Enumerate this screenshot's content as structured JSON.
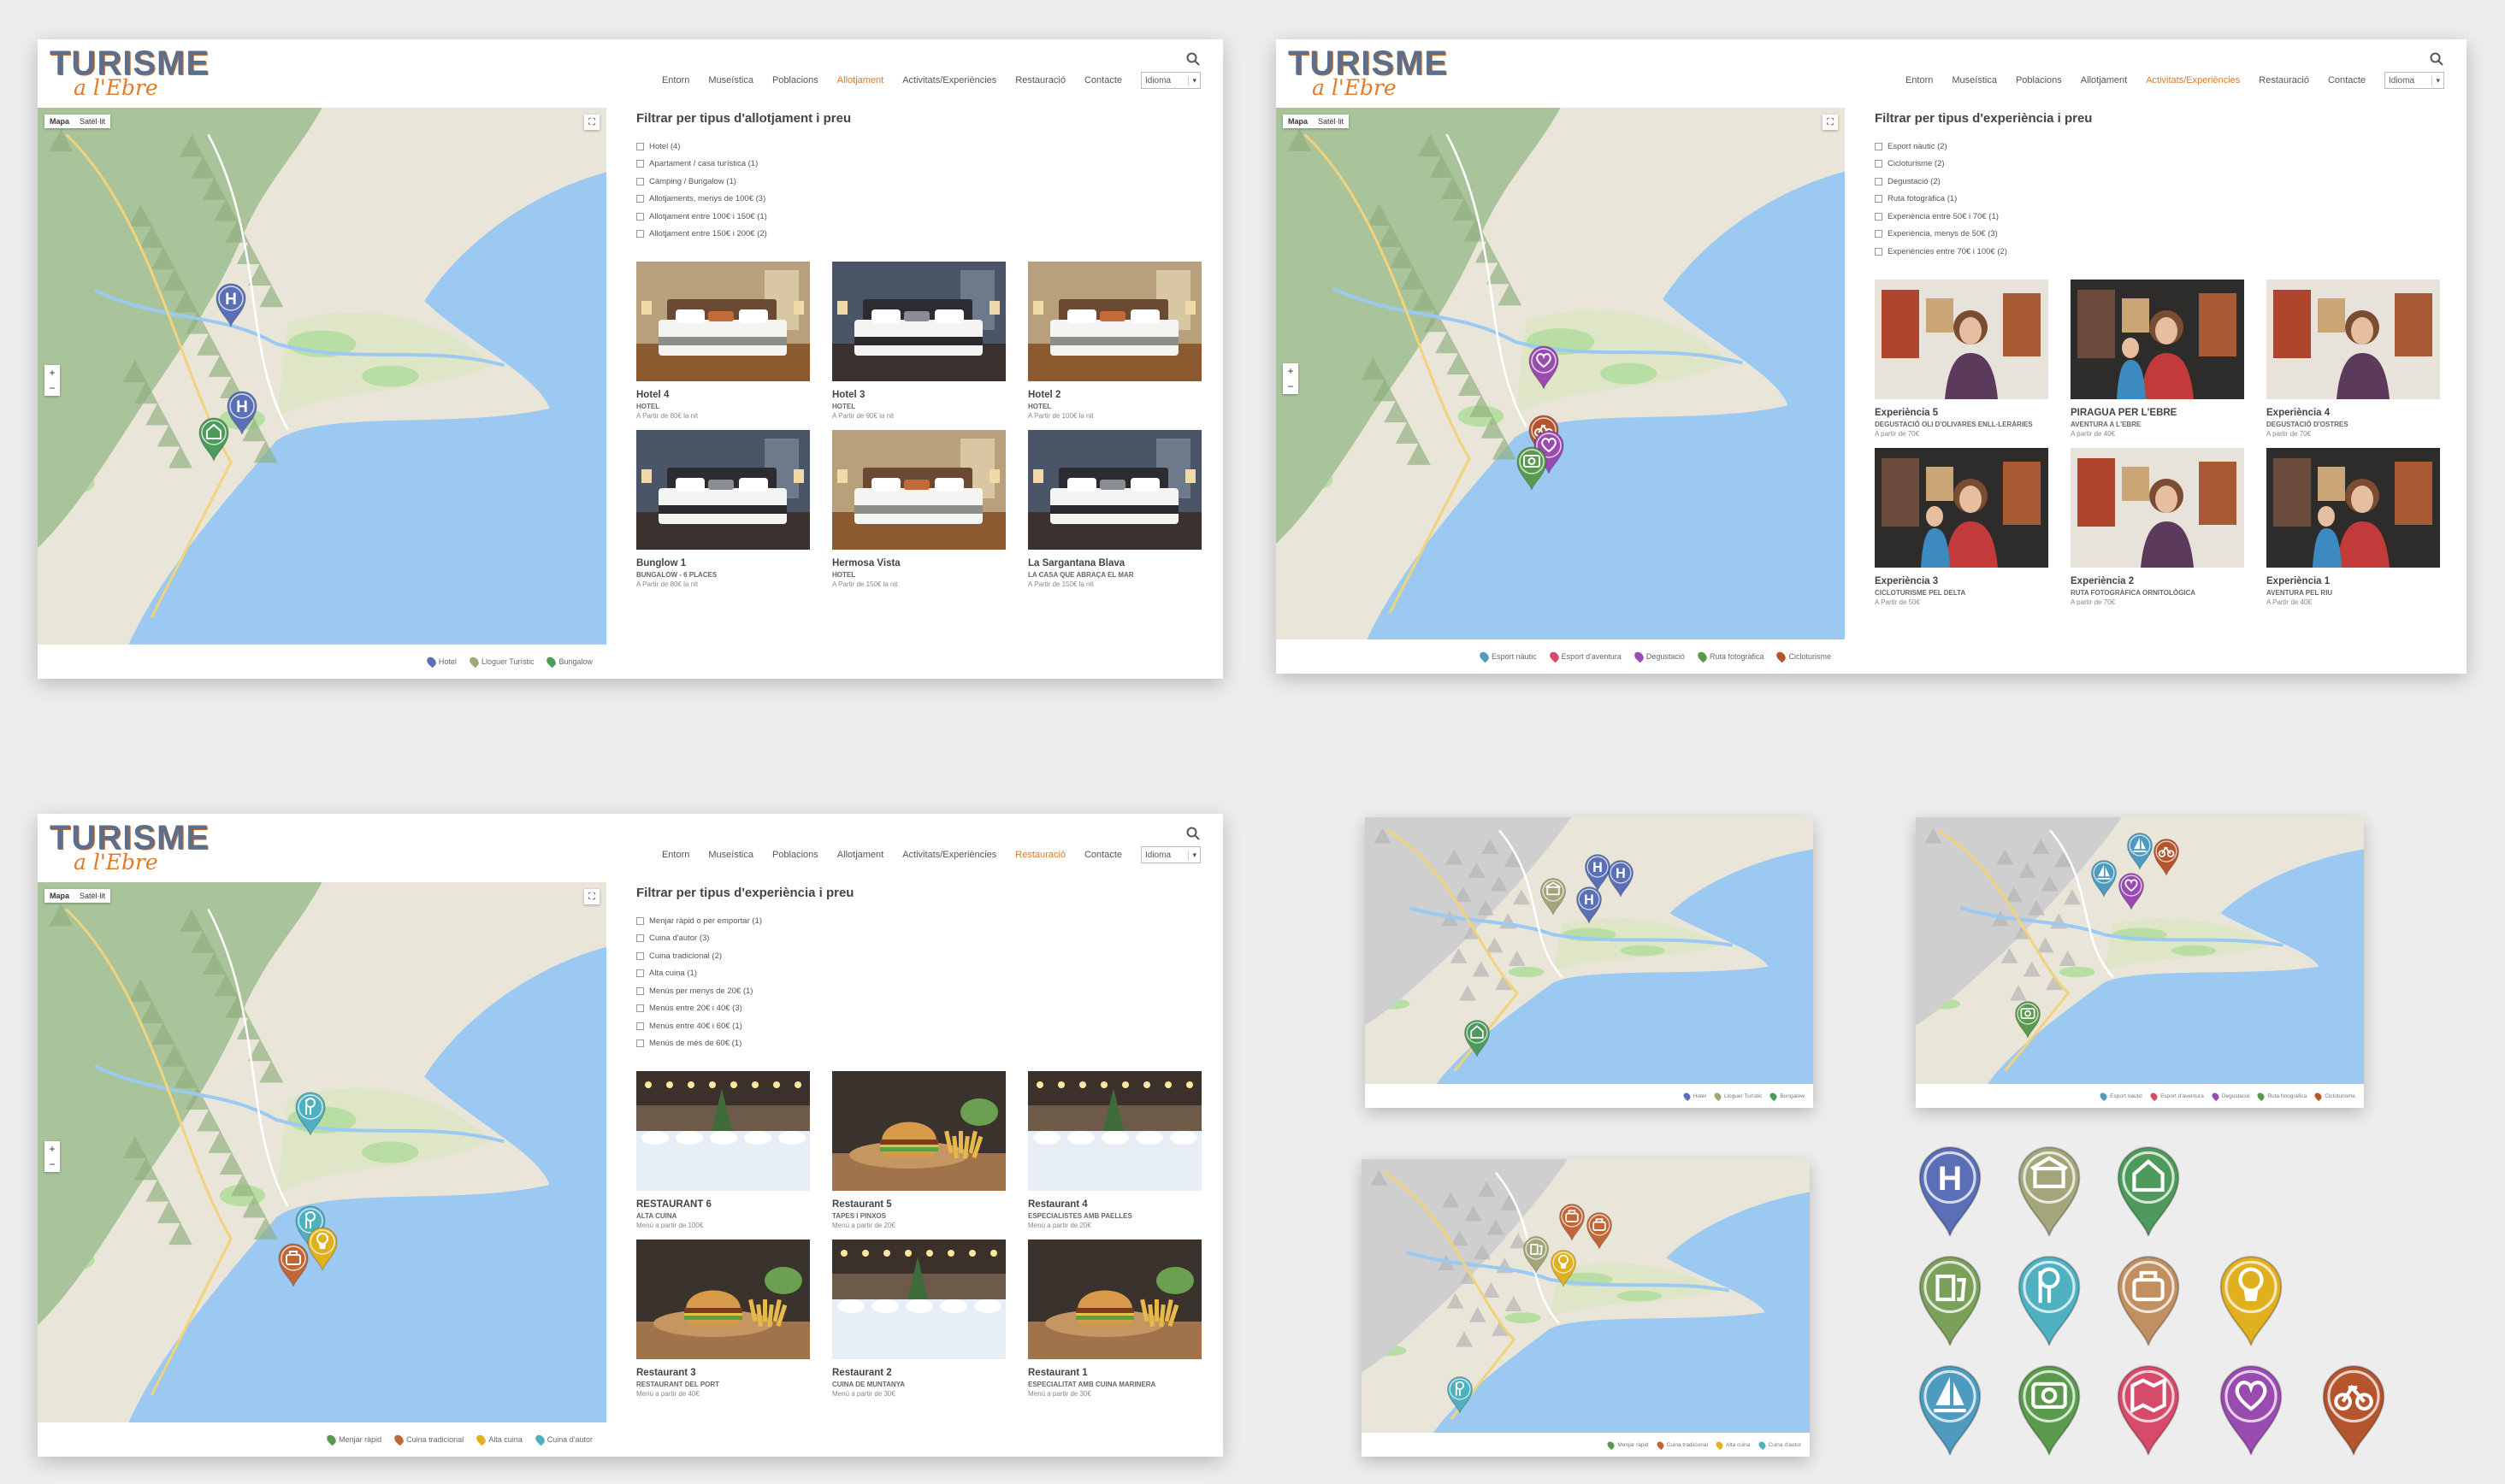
{
  "site": {
    "logo_main": "TURISME",
    "logo_sub": "a l'Ebre",
    "language_label": "Idioma",
    "nav": [
      "Entorn",
      "Museística",
      "Poblacions",
      "Allotjament",
      "Activitats/Experiències",
      "Restauració",
      "Contacte"
    ]
  },
  "map_ui": {
    "type_map": "Mapa",
    "type_satellite": "Satèl·lit",
    "zoom_in": "+",
    "zoom_out": "−"
  },
  "panels": {
    "accommodation": {
      "active_nav": 3,
      "filter_title": "Filtrar per tipus d'allotjament i preu",
      "filters": [
        "Hotel (4)",
        "Apartament / casa turística (1)",
        "Càmping / Bungalow (1)",
        "Allotjaments, menys de 100€ (3)",
        "Allotjament entre 100€ i 150€ (1)",
        "Allotjament entre 150€ i 200€ (2)"
      ],
      "cards": [
        {
          "title": "Hotel 4",
          "subtitle": "HOTEL",
          "price": "A Partir de 80€ la nit",
          "image": "bedroom"
        },
        {
          "title": "Hotel 3",
          "subtitle": "HOTEL",
          "price": "A Partir de 90€ la nit",
          "image": "bedroom-dark"
        },
        {
          "title": "Hotel 2",
          "subtitle": "HOTEL",
          "price": "A Partir de 100€ la nit",
          "image": "bedroom"
        },
        {
          "title": "Bunglow 1",
          "subtitle": "BUNGALOW - 6 PLACES",
          "price": "A Partir de 80€ la nit",
          "image": "bedroom-dark"
        },
        {
          "title": "Hermosa Vista",
          "subtitle": "HOTEL",
          "price": "A Partir de 150€ la nit",
          "image": "bedroom"
        },
        {
          "title": "La Sargantana Blava",
          "subtitle": "LA CASA QUE ABRAÇA EL MAR",
          "price": "A Partir de 150€ la nit",
          "image": "bedroom-dark"
        }
      ],
      "legend": [
        {
          "label": "Hotel",
          "color": "#5a6fb5"
        },
        {
          "label": "Lloguer Turístic",
          "color": "#a3a67a"
        },
        {
          "label": "Bungalow",
          "color": "#4e9a5c"
        }
      ],
      "markers": [
        {
          "icon": "hotel-marker-icon",
          "color": "#5a6fb5"
        },
        {
          "icon": "hotel-marker-icon",
          "color": "#5a6fb5"
        },
        {
          "icon": "bungalow-marker-icon",
          "color": "#4e9a5c"
        }
      ]
    },
    "experiences": {
      "active_nav": 4,
      "filter_title": "Filtrar per tipus d'experiència i preu",
      "filters": [
        "Esport nàutic (2)",
        "Cicloturisme (2)",
        "Degustació (2)",
        "Ruta fotogràfica (1)",
        "Experiència entre 50€ i 70€ (1)",
        "Experiència, menys de 50€ (3)",
        "Experiències entre 70€ i 100€ (2)"
      ],
      "cards": [
        {
          "title": "Experiència 5",
          "subtitle": "Degustació oli d'olivares enll·leràries",
          "price": "A partir de 70€",
          "image": "gallery"
        },
        {
          "title": "PIRAGUA PER L'EBRE",
          "subtitle": "AVENTURA A L'EBRE",
          "price": "A partir de 40€",
          "image": "gallery-kids"
        },
        {
          "title": "Experiència 4",
          "subtitle": "Degustació d'ostres",
          "price": "A partir de 70€",
          "image": "gallery"
        },
        {
          "title": "Experiència 3",
          "subtitle": "cicloturisme pel delta",
          "price": "A Partir de 50€",
          "image": "gallery-kids"
        },
        {
          "title": "Experiència 2",
          "subtitle": "Ruta fotogràfica ornitològica",
          "price": "A partir de 70€",
          "image": "gallery"
        },
        {
          "title": "Experiència 1",
          "subtitle": "AVENTURA PEL RIU",
          "price": "A Partir de 40€",
          "image": "gallery-kids"
        }
      ],
      "legend": [
        {
          "label": "Esport nàutic",
          "color": "#4f9bc0"
        },
        {
          "label": "Esport d'aventura",
          "color": "#d64a6a"
        },
        {
          "label": "Degustació",
          "color": "#9a4bb0"
        },
        {
          "label": "Ruta fotogràfica",
          "color": "#5a9a4c"
        },
        {
          "label": "Cicloturisme",
          "color": "#b4552e"
        }
      ],
      "markers": [
        {
          "icon": "tasting-marker-icon",
          "color": "#9a4bb0"
        },
        {
          "icon": "cycling-marker-icon",
          "color": "#b4552e"
        },
        {
          "icon": "tasting-marker-icon",
          "color": "#9a4bb0"
        },
        {
          "icon": "photo-marker-icon",
          "color": "#5a9a4c"
        }
      ]
    },
    "restaurants": {
      "active_nav": 5,
      "filter_title": "Filtrar per tipus d'experiència i preu",
      "filters": [
        "Menjar ràpid o per emportar (1)",
        "Cuina d'autor (3)",
        "Cuina tradicional (2)",
        "Alta cuina (1)",
        "Menús per menys de 20€ (1)",
        "Menús entre 20€ i 40€ (3)",
        "Menús entre 40€ i 60€ (1)",
        "Menús de més de 60€ (1)"
      ],
      "cards": [
        {
          "title": "RESTAURANT 6",
          "subtitle": "Alta cuina",
          "price": "Menú a partir de 100€",
          "image": "dining"
        },
        {
          "title": "Restaurant 5",
          "subtitle": "TAPES I PINXOS",
          "price": "Menú a partir de 20€",
          "image": "burger"
        },
        {
          "title": "Restaurant 4",
          "subtitle": "ESPECIALISTES AMB PAELLES",
          "price": "Menú a partir de 20€",
          "image": "dining"
        },
        {
          "title": "Restaurant 3",
          "subtitle": "RESTAURANT DEL PORT",
          "price": "Menú a partir de 40€",
          "image": "burger"
        },
        {
          "title": "Restaurant 2",
          "subtitle": "CUINA DE MUNTANYA",
          "price": "Menú a partir de 30€",
          "image": "dining"
        },
        {
          "title": "Restaurant 1",
          "subtitle": "ESPECIALITAT AMB CUINA MARINERA",
          "price": "Menú a partir de 30€",
          "image": "burger"
        }
      ],
      "legend": [
        {
          "label": "Menjar ràpid",
          "color": "#5a9a4c"
        },
        {
          "label": "Cuina tradicional",
          "color": "#c0673a"
        },
        {
          "label": "Alta cuina",
          "color": "#e0b01e"
        },
        {
          "label": "Cuina d'autor",
          "color": "#4fb0c0"
        }
      ],
      "markers": [
        {
          "icon": "fork-knife-marker-icon",
          "color": "#4fb0c0"
        },
        {
          "icon": "fork-knife-marker-icon",
          "color": "#4fb0c0"
        },
        {
          "icon": "haute-cuisine-marker-icon",
          "color": "#e0b01e"
        },
        {
          "icon": "traditional-marker-icon",
          "color": "#c0673a"
        }
      ]
    }
  },
  "thumbnails": [
    {
      "legend": [
        {
          "label": "Hotel",
          "color": "#5a6fb5"
        },
        {
          "label": "Lloguer Turístic",
          "color": "#a3a67a"
        },
        {
          "label": "Bungalow",
          "color": "#4e9a5c"
        }
      ],
      "markers": [
        {
          "icon": "hotel-marker-icon",
          "color": "#5a6fb5"
        },
        {
          "icon": "hotel-marker-icon",
          "color": "#5a6fb5"
        },
        {
          "icon": "hotel-marker-icon",
          "color": "#5a6fb5"
        },
        {
          "icon": "rental-marker-icon",
          "color": "#a3a67a"
        },
        {
          "icon": "bungalow-marker-icon",
          "color": "#4e9a5c"
        }
      ]
    },
    {
      "legend": [
        {
          "label": "Esport nàutic",
          "color": "#4f9bc0"
        },
        {
          "label": "Esport d'aventura",
          "color": "#d64a6a"
        },
        {
          "label": "Degustació",
          "color": "#9a4bb0"
        },
        {
          "label": "Ruta fotogràfica",
          "color": "#5a9a4c"
        },
        {
          "label": "Cicloturisme",
          "color": "#b4552e"
        }
      ],
      "markers": [
        {
          "icon": "sailing-marker-icon",
          "color": "#4f9bc0"
        },
        {
          "icon": "sailing-marker-icon",
          "color": "#4f9bc0"
        },
        {
          "icon": "cycling-marker-icon",
          "color": "#b4552e"
        },
        {
          "icon": "tasting-marker-icon",
          "color": "#9a4bb0"
        },
        {
          "icon": "photo-marker-icon",
          "color": "#5a9a4c"
        }
      ]
    },
    {
      "legend": [
        {
          "label": "Menjar ràpid",
          "color": "#5a9a4c"
        },
        {
          "label": "Cuina tradicional",
          "color": "#c0673a"
        },
        {
          "label": "Alta cuina",
          "color": "#e0b01e"
        },
        {
          "label": "Cuina d'autor",
          "color": "#4fb0c0"
        }
      ],
      "markers": [
        {
          "icon": "traditional-marker-icon",
          "color": "#c0673a"
        },
        {
          "icon": "traditional-marker-icon",
          "color": "#c0673a"
        },
        {
          "icon": "fast-food-marker-icon",
          "color": "#a3a67a"
        },
        {
          "icon": "haute-cuisine-marker-icon",
          "color": "#e0b01e"
        },
        {
          "icon": "fork-knife-marker-icon",
          "color": "#4fb0c0"
        }
      ]
    }
  ],
  "icon_set": [
    {
      "icon": "hotel-marker-icon",
      "color": "#5a6fb5"
    },
    {
      "icon": "rental-marker-icon",
      "color": "#a3a67a"
    },
    {
      "icon": "bungalow-marker-icon",
      "color": "#4e9a5c"
    },
    {
      "icon": "fast-food-marker-icon",
      "color": "#7aa05a"
    },
    {
      "icon": "fork-knife-marker-icon",
      "color": "#4fb0c0"
    },
    {
      "icon": "traditional-marker-icon",
      "color": "#c29060"
    },
    {
      "icon": "haute-cuisine-marker-icon",
      "color": "#e0b01e"
    },
    {
      "icon": "sailing-marker-icon",
      "color": "#4f9bc0"
    },
    {
      "icon": "photo-marker-icon",
      "color": "#5a9a4c"
    },
    {
      "icon": "adventure-marker-icon",
      "color": "#d64a6a"
    },
    {
      "icon": "tasting-marker-icon",
      "color": "#9a4bb0"
    },
    {
      "icon": "cycling-marker-icon",
      "color": "#b4552e"
    }
  ]
}
